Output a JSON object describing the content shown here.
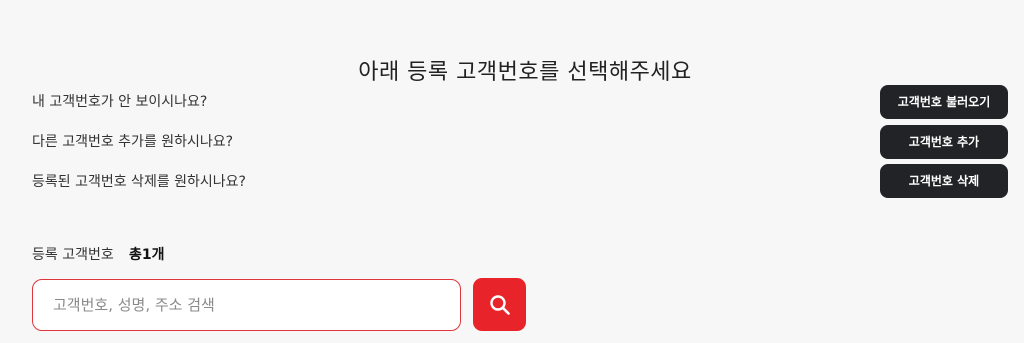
{
  "header": {
    "title": "아래 등록 고객번호를 선택해주세요"
  },
  "help": {
    "items": [
      {
        "question": "내 고객번호가 안 보이시나요?",
        "button_label": "고객번호 불러오기"
      },
      {
        "question": "다른 고객번호 추가를 원하시나요?",
        "button_label": "고객번호 추가"
      },
      {
        "question": "등록된 고객번호 삭제를 원하시나요?",
        "button_label": "고객번호 삭제"
      }
    ]
  },
  "registered": {
    "label": "등록 고객번호",
    "count_text": "총1개"
  },
  "search": {
    "value": "",
    "placeholder": "고객번호, 성명, 주소 검색",
    "button_icon": "search-icon"
  },
  "colors": {
    "accent": "#e8232a",
    "dark_button": "#222326",
    "background": "#f7f7f7",
    "input_border": "#e0353b"
  }
}
